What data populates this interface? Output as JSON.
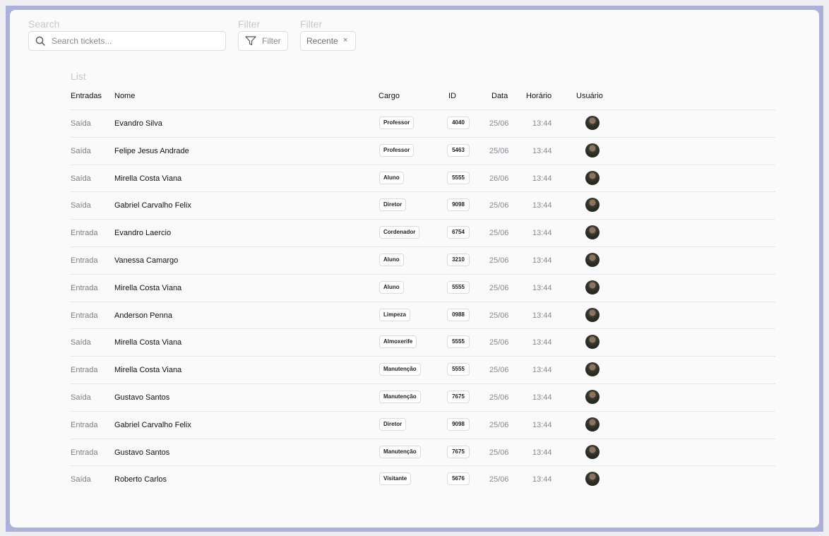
{
  "labels": {
    "search": "Search",
    "filter1": "Filter",
    "filter2": "Filter",
    "list": "List"
  },
  "search": {
    "placeholder": "Search tickets..."
  },
  "filter_button": {
    "label": "Filter"
  },
  "active_filter": {
    "label": "Recente",
    "remove": "×"
  },
  "icons": {
    "search": "search-icon",
    "filter": "filter-icon",
    "avatar": "avatar"
  },
  "columns": [
    "Entradas",
    "Nome",
    "Cargo",
    "ID",
    "Data",
    "Horário",
    "Usuário"
  ],
  "rows": [
    {
      "type": "Saída",
      "name": "Evandro Silva",
      "role": "Professor",
      "id": "4040",
      "date": "25/06",
      "time": "13:44"
    },
    {
      "type": "Saída",
      "name": "Felipe Jesus Andrade",
      "role": "Professor",
      "id": "5463",
      "date": "25/06",
      "time": "13:44"
    },
    {
      "type": "Saída",
      "name": "Mirella Costa Viana",
      "role": "Aluno",
      "id": "5555",
      "date": "26/06",
      "time": "13:44"
    },
    {
      "type": "Saída",
      "name": "Gabriel Carvalho Felix",
      "role": "Diretor",
      "id": "9098",
      "date": "25/06",
      "time": "13:44"
    },
    {
      "type": "Entrada",
      "name": "Evandro Laercio",
      "role": "Cordenador",
      "id": "6754",
      "date": "25/06",
      "time": "13:44"
    },
    {
      "type": "Entrada",
      "name": "Vanessa Camargo",
      "role": "Aluno",
      "id": "3210",
      "date": "25/06",
      "time": "13:44"
    },
    {
      "type": "Entrada",
      "name": "Mirella Costa Viana",
      "role": "Aluno",
      "id": "5555",
      "date": "25/06",
      "time": "13:44"
    },
    {
      "type": "Entrada",
      "name": "Anderson Penna",
      "role": "Limpeza",
      "id": "0988",
      "date": "25/06",
      "time": "13:44"
    },
    {
      "type": "Saída",
      "name": "Mirella Costa Viana",
      "role": "Almoxerife",
      "id": "5555",
      "date": "25/06",
      "time": "13:44"
    },
    {
      "type": "Entrada",
      "name": "Mirella Costa Viana",
      "role": "Manutenção",
      "id": "5555",
      "date": "25/06",
      "time": "13:44"
    },
    {
      "type": "Saída",
      "name": "Gustavo Santos",
      "role": "Manutenção",
      "id": "7675",
      "date": "25/06",
      "time": "13:44"
    },
    {
      "type": "Entrada",
      "name": "Gabriel Carvalho Felix",
      "role": "Diretor",
      "id": "9098",
      "date": "25/06",
      "time": "13:44"
    },
    {
      "type": "Entrada",
      "name": "Gustavo Santos",
      "role": "Manutenção",
      "id": "7675",
      "date": "25/06",
      "time": "13:44"
    },
    {
      "type": "Saída",
      "name": "Roberto Carlos",
      "role": "Visitante",
      "id": "5676",
      "date": "25/06",
      "time": "13:44"
    }
  ],
  "colors": {
    "frame": "#aeb0dc",
    "card": "#fafafa",
    "muted_label": "#c8c8cc"
  }
}
